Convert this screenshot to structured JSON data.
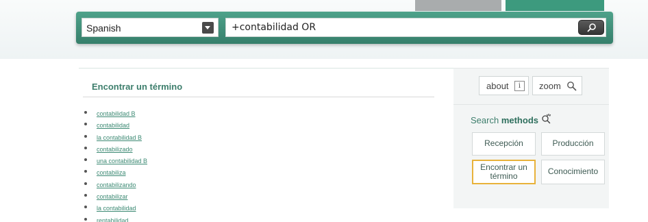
{
  "header": {
    "language": "Spanish",
    "query": "+contabilidad OR",
    "search_icon": "search-icon",
    "dropdown_icon": "chevron-down-icon",
    "accent_color": "#3f8f78"
  },
  "left": {
    "title": "Encontrar un término",
    "results": [
      "contabilidad B",
      "contabilidad",
      "la contabilidad B",
      "contabilizado",
      "una contabilidad B",
      "contabiliza",
      "contabilizando",
      "contabilizar",
      "la contabilidad",
      "rentabilidad"
    ]
  },
  "right": {
    "about_label": "about",
    "about_icon_text": "i",
    "zoom_label": "zoom",
    "methods_prefix": "Search ",
    "methods_bold": "methods",
    "methods": {
      "recepcion": "Recepción",
      "produccion": "Producción",
      "encontrar": "Encontrar un término",
      "conocimiento": "Conocimiento"
    },
    "selected_method": "encontrar",
    "selected_color": "#e8b23a"
  }
}
